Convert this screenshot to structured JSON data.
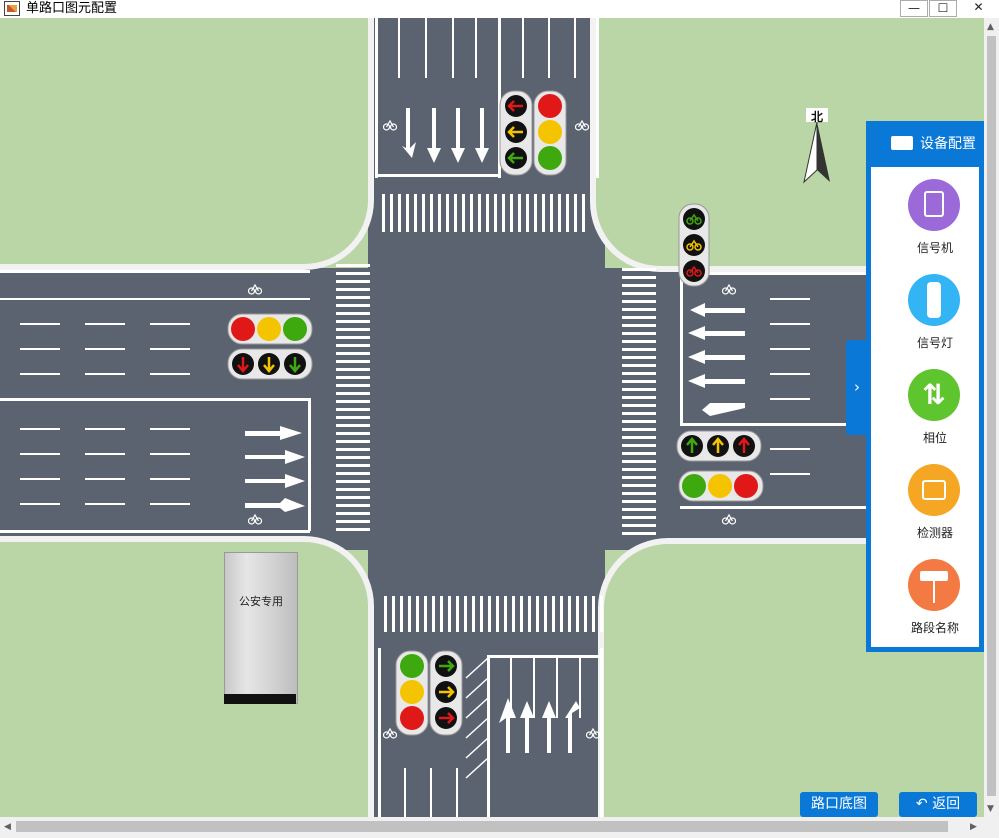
{
  "window": {
    "title": "单路口图元配置",
    "minimize_glyph": "—",
    "maximize_glyph": "☐",
    "close_glyph": "✕"
  },
  "map": {
    "compass_label": "北",
    "cabinet_label": "公安专用"
  },
  "device_panel": {
    "title": "设备配置",
    "items": [
      {
        "label": "信号机",
        "icon": "signal-controller-icon",
        "color": "#9b6ad8"
      },
      {
        "label": "信号灯",
        "icon": "traffic-light-icon",
        "color": "#33b5f5"
      },
      {
        "label": "相位",
        "icon": "phase-arrows-icon",
        "color": "#5fc52e"
      },
      {
        "label": "检测器",
        "icon": "detector-icon",
        "color": "#f5a623"
      },
      {
        "label": "路段名称",
        "icon": "road-sign-icon",
        "color": "#f47a43"
      }
    ],
    "collapse_glyph": "›"
  },
  "buttons": {
    "base_map": "路口底图",
    "back": "返回"
  },
  "colors": {
    "road": "#5b6370",
    "grass": "#bad5a6",
    "accent": "#0a78d7",
    "red": "#e01818",
    "yellow": "#f5c400",
    "green": "#3ea80f"
  }
}
